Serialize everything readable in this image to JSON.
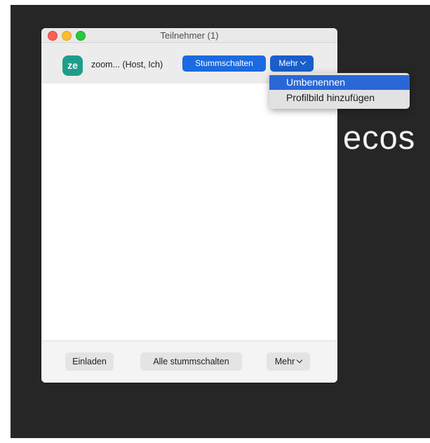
{
  "background": {
    "partial_text": "ecos"
  },
  "window": {
    "title": "Teilnehmer (1)"
  },
  "participant": {
    "avatar_initials": "ze",
    "name": "zoom... (Host, Ich)",
    "mute_button": "Stummschalten",
    "more_button": "Mehr"
  },
  "dropdown_menu": {
    "items": [
      {
        "label": "Umbenennen",
        "selected": true
      },
      {
        "label": "Profilbild hinzufügen",
        "selected": false
      }
    ]
  },
  "footer": {
    "invite_button": "Einladen",
    "mute_all_button": "Alle stummschalten",
    "more_button": "Mehr"
  },
  "colors": {
    "accent_blue": "#1c6ae0",
    "avatar_teal": "#1d9e8a",
    "backdrop": "#262626"
  }
}
